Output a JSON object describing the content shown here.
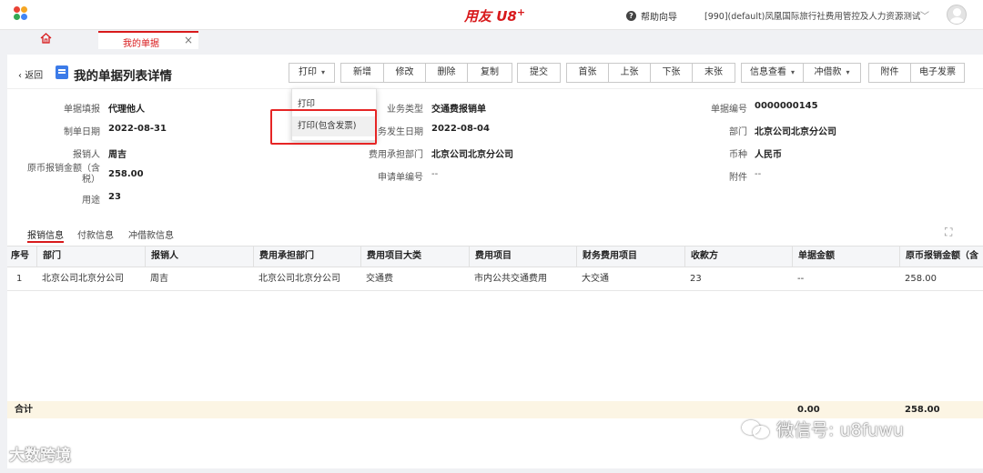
{
  "brand": {
    "name": "用友 U8",
    "sup": "+"
  },
  "header": {
    "help_label": "帮助向导",
    "org_label": "[990](default)凤凰国际旅行社费用管控及人力资源测试"
  },
  "tabs": {
    "doc_tab_label": "我的单据"
  },
  "page": {
    "back_label": "返回",
    "title": "我的单据列表详情"
  },
  "toolbar": {
    "print": "打印",
    "add": "新增",
    "edit": "修改",
    "delete": "删除",
    "copy": "复制",
    "submit": "提交",
    "first": "首张",
    "prev": "上张",
    "next": "下张",
    "last": "末张",
    "info_view": "信息查看",
    "offset": "冲借款",
    "attachment": "附件",
    "e_invoice": "电子发票"
  },
  "print_menu": {
    "items": [
      "打印",
      "打印(包含发票)"
    ]
  },
  "form": {
    "fields": [
      {
        "label": "单据填报",
        "value": "代理他人"
      },
      {
        "label": "制单日期",
        "value": "2022-08-31"
      },
      {
        "label": "报销人",
        "value": "周吉"
      },
      {
        "label": "原币报销金额（含税）",
        "value": "258.00"
      },
      {
        "label": "用途",
        "value": "23"
      },
      {
        "label": "业务类型",
        "value": "交通费报销单"
      },
      {
        "label": "业务发生日期",
        "value": "2022-08-04"
      },
      {
        "label": "费用承担部门",
        "value": "北京公司北京分公司"
      },
      {
        "label": "申请单编号",
        "value": "--"
      },
      {
        "label": "单据编号",
        "value": "0000000145"
      },
      {
        "label": "部门",
        "value": "北京公司北京分公司"
      },
      {
        "label": "币种",
        "value": "人民币"
      },
      {
        "label": "附件",
        "value": "--"
      }
    ]
  },
  "detail_tabs": [
    "报销信息",
    "付款信息",
    "冲借款信息"
  ],
  "table": {
    "columns": [
      "序号",
      "部门",
      "报销人",
      "费用承担部门",
      "费用项目大类",
      "费用项目",
      "财务费用项目",
      "收款方",
      "单据金额",
      "原币报销金额（含"
    ],
    "rows": [
      [
        "1",
        "北京公司北京分公司",
        "周吉",
        "北京公司北京分公司",
        "交通费",
        "市内公共交通费用",
        "大交通",
        "23",
        "--",
        "258.00"
      ]
    ],
    "total_label": "合计",
    "total_amount": "0.00",
    "total_reimburse": "258.00"
  },
  "watermarks": {
    "left": "大数跨境",
    "right": "微信号: u8fuwu"
  },
  "colors": {
    "brand_red": "#d8191b",
    "highlight_red": "#e62525",
    "title_icon_blue": "#3c7be8",
    "total_row_bg": "#fcf5e4"
  }
}
